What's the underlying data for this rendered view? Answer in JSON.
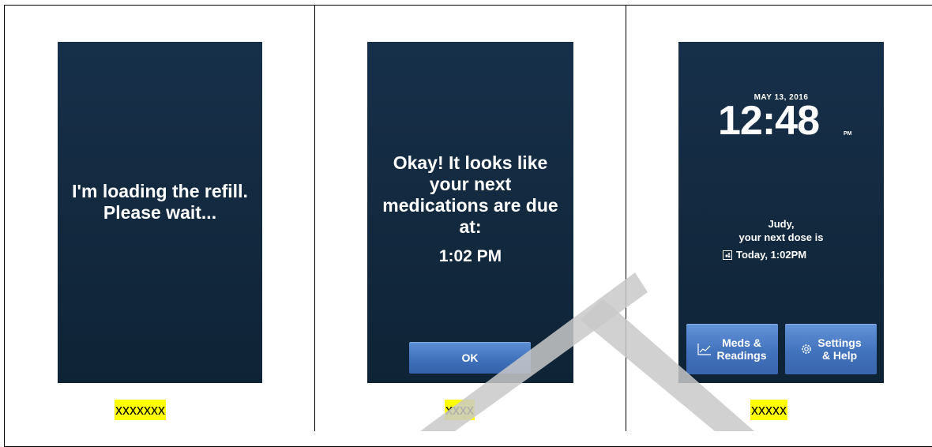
{
  "panels": [
    {
      "message": "I'm loading the refill. Please wait...",
      "caption": "xxxxxxx"
    },
    {
      "message": "Okay! It looks like your next medications are due at:",
      "due_time": "1:02 PM",
      "ok_label": "OK",
      "caption": "xxxx"
    },
    {
      "date": "MAY 13, 2016",
      "time": "12:48",
      "ampm": "PM",
      "greeting_name": "Judy,",
      "greeting_text": "your next dose is",
      "next_dose": "Today, 1:02PM",
      "meds_label_1": "Meds &",
      "meds_label_2": "Readings",
      "settings_label_1": "Settings",
      "settings_label_2": "& Help",
      "caption": "xxxxx"
    }
  ],
  "colors": {
    "screen_bg": "#132a40",
    "button_blue": "#4a7cc8",
    "caption_highlight": "#ffff00",
    "watermark": "#cccccc"
  },
  "icons": {
    "dose": "pill-dispenser-icon",
    "meds": "chart-line-icon",
    "settings": "gear-icon"
  }
}
